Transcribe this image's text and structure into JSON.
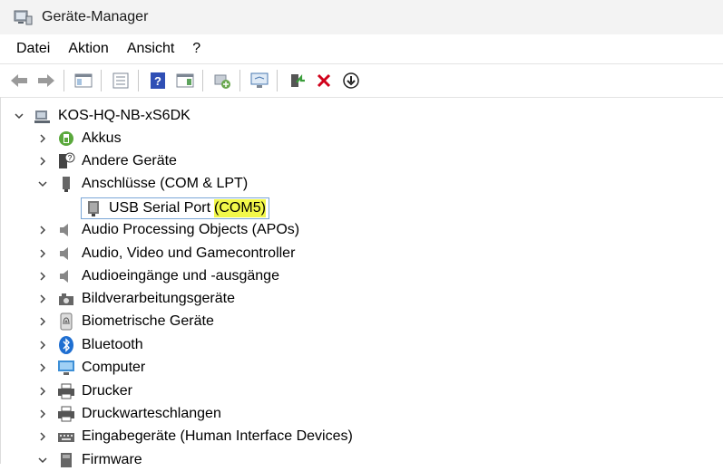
{
  "window": {
    "title": "Geräte-Manager"
  },
  "menu": [
    "Datei",
    "Aktion",
    "Ansicht",
    "?"
  ],
  "toolbar": {
    "buttons": [
      "back-icon",
      "forward-icon",
      "properties-view-icon",
      "console-tree-icon",
      "help-icon",
      "action-pane-icon",
      "update-driver-icon",
      "scan-hardware-icon",
      "enable-device-icon",
      "uninstall-icon",
      "download-icon"
    ]
  },
  "tree": {
    "root": "KOS-HQ-NB-xS6DK",
    "expanded_child": {
      "name": "USB Serial Port",
      "port": "(COM5)"
    },
    "categories": [
      "Akkus",
      "Andere Geräte",
      "Anschlüsse (COM & LPT)",
      "Audio Processing Objects (APOs)",
      "Audio, Video und Gamecontroller",
      "Audioeingänge und -ausgänge",
      "Bildverarbeitungsgeräte",
      "Biometrische Geräte",
      "Bluetooth",
      "Computer",
      "Drucker",
      "Druckwarteschlangen",
      "Eingabegeräte (Human Interface Devices)",
      "Firmware"
    ]
  },
  "colors": {
    "highlight": "#f2f84a",
    "selection_border": "#7aa6d6",
    "error_red": "#d0021b"
  }
}
